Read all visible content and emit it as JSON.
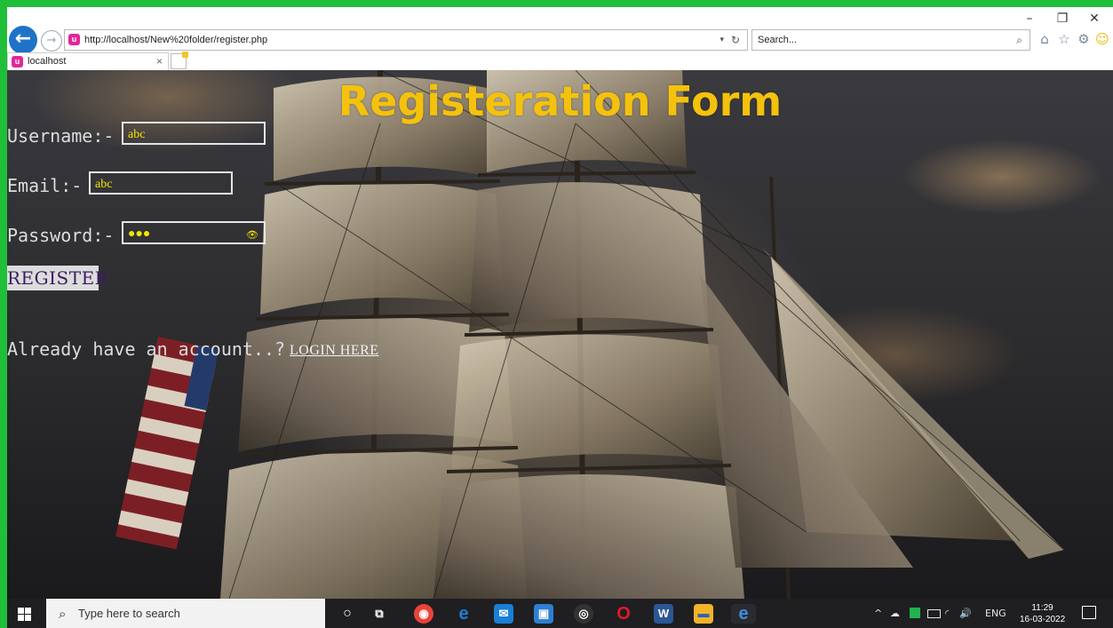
{
  "window": {
    "minimize": "–",
    "restore": "❐",
    "close": "✕"
  },
  "browser": {
    "back_icon": "arrow-left-icon",
    "back_glyph": "←",
    "forward_glyph": "→",
    "site_glyph": "u",
    "url": "http://localhost/New%20folder/register.php",
    "url_dropdown": "▾",
    "refresh_glyph": "↻",
    "search_placeholder": "Search...",
    "search_glyph": "⌕",
    "home_glyph": "⌂",
    "favorites_glyph": "☆",
    "settings_glyph": "⚙",
    "smiley_glyph": "☺",
    "tab_title": "localhost",
    "tab_close": "×"
  },
  "page": {
    "title": "Registeration Form",
    "username_label": "Username:-",
    "username_value": "abc",
    "email_label": "Email:-",
    "email_value": "abc",
    "password_label": "Password:-",
    "password_value": "●●●",
    "password_eye": "👁",
    "register_button": "REGISTER",
    "already_text": "Already have an account..?",
    "login_link": "LOGIN HERE"
  },
  "taskbar": {
    "search_placeholder": "Type here to search",
    "search_glyph": "⌕",
    "cortana_glyph": "○",
    "taskview_glyph": "⧉",
    "apps": [
      {
        "name": "chrome-icon",
        "glyph": "◉",
        "color": "#e8443a"
      },
      {
        "name": "edge-icon",
        "glyph": "e",
        "color": "#1a7fd6"
      },
      {
        "name": "mail-icon",
        "glyph": "✉",
        "color": "#1a7fd6"
      },
      {
        "name": "store-icon",
        "glyph": "▣",
        "color": "#2d7fd3"
      },
      {
        "name": "media-icon",
        "glyph": "◎",
        "color": "#333"
      },
      {
        "name": "opera-icon",
        "glyph": "O",
        "color": "#e01b24"
      },
      {
        "name": "word-icon",
        "glyph": "W",
        "color": "#2b5797"
      },
      {
        "name": "file-explorer-icon",
        "glyph": "▬",
        "color": "#f3b32a"
      },
      {
        "name": "internet-explorer-icon",
        "glyph": "e",
        "color": "#3d8fe0"
      }
    ],
    "tray": {
      "chevron": "^",
      "cloud": "☁",
      "lang": "ENG",
      "volume": "🔊",
      "wifi": "◜"
    },
    "time": "11:29",
    "date": "16-03-2022"
  }
}
